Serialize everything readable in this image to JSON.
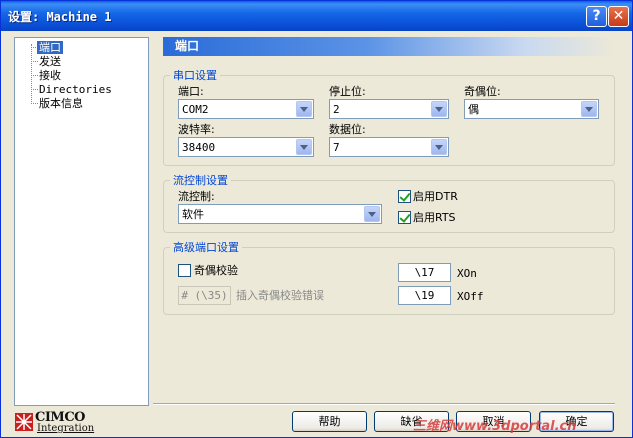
{
  "window": {
    "title": "设置: Machine 1",
    "help_glyph": "?",
    "close_glyph": "✕"
  },
  "tree": {
    "items": [
      {
        "label": "端口",
        "selected": true
      },
      {
        "label": "发送",
        "selected": false
      },
      {
        "label": "接收",
        "selected": false
      },
      {
        "label": "Directories",
        "selected": false
      },
      {
        "label": "版本信息",
        "selected": false
      }
    ]
  },
  "logo": {
    "name": "CIMCO",
    "sub": "Integration"
  },
  "panel": {
    "header": "端口"
  },
  "serial": {
    "title": "串口设置",
    "port_label": "端口:",
    "port_value": "COM2",
    "stopbits_label": "停止位:",
    "stopbits_value": "2",
    "parity_label": "奇偶位:",
    "parity_value": "偶",
    "baud_label": "波特率:",
    "baud_value": "38400",
    "databits_label": "数据位:",
    "databits_value": "7"
  },
  "flow": {
    "title": "流控制设置",
    "flow_label": "流控制:",
    "flow_value": "软件",
    "dtr_label": "启用DTR",
    "dtr_checked": true,
    "rts_label": "启用RTS",
    "rts_checked": true
  },
  "advanced": {
    "title": "高级端口设置",
    "parity_check_label": "奇偶校验",
    "parity_check_checked": false,
    "parity_error_value": "# (\\35)",
    "parity_error_label": "插入奇偶校验错误",
    "xon_value": "\\17",
    "xon_label": "XOn",
    "xoff_value": "\\19",
    "xoff_label": "XOff"
  },
  "buttons": {
    "help": "帮助",
    "default": "缺省",
    "cancel": "取消",
    "ok": "确定"
  },
  "watermark": "三维网www.3dportal.cn"
}
